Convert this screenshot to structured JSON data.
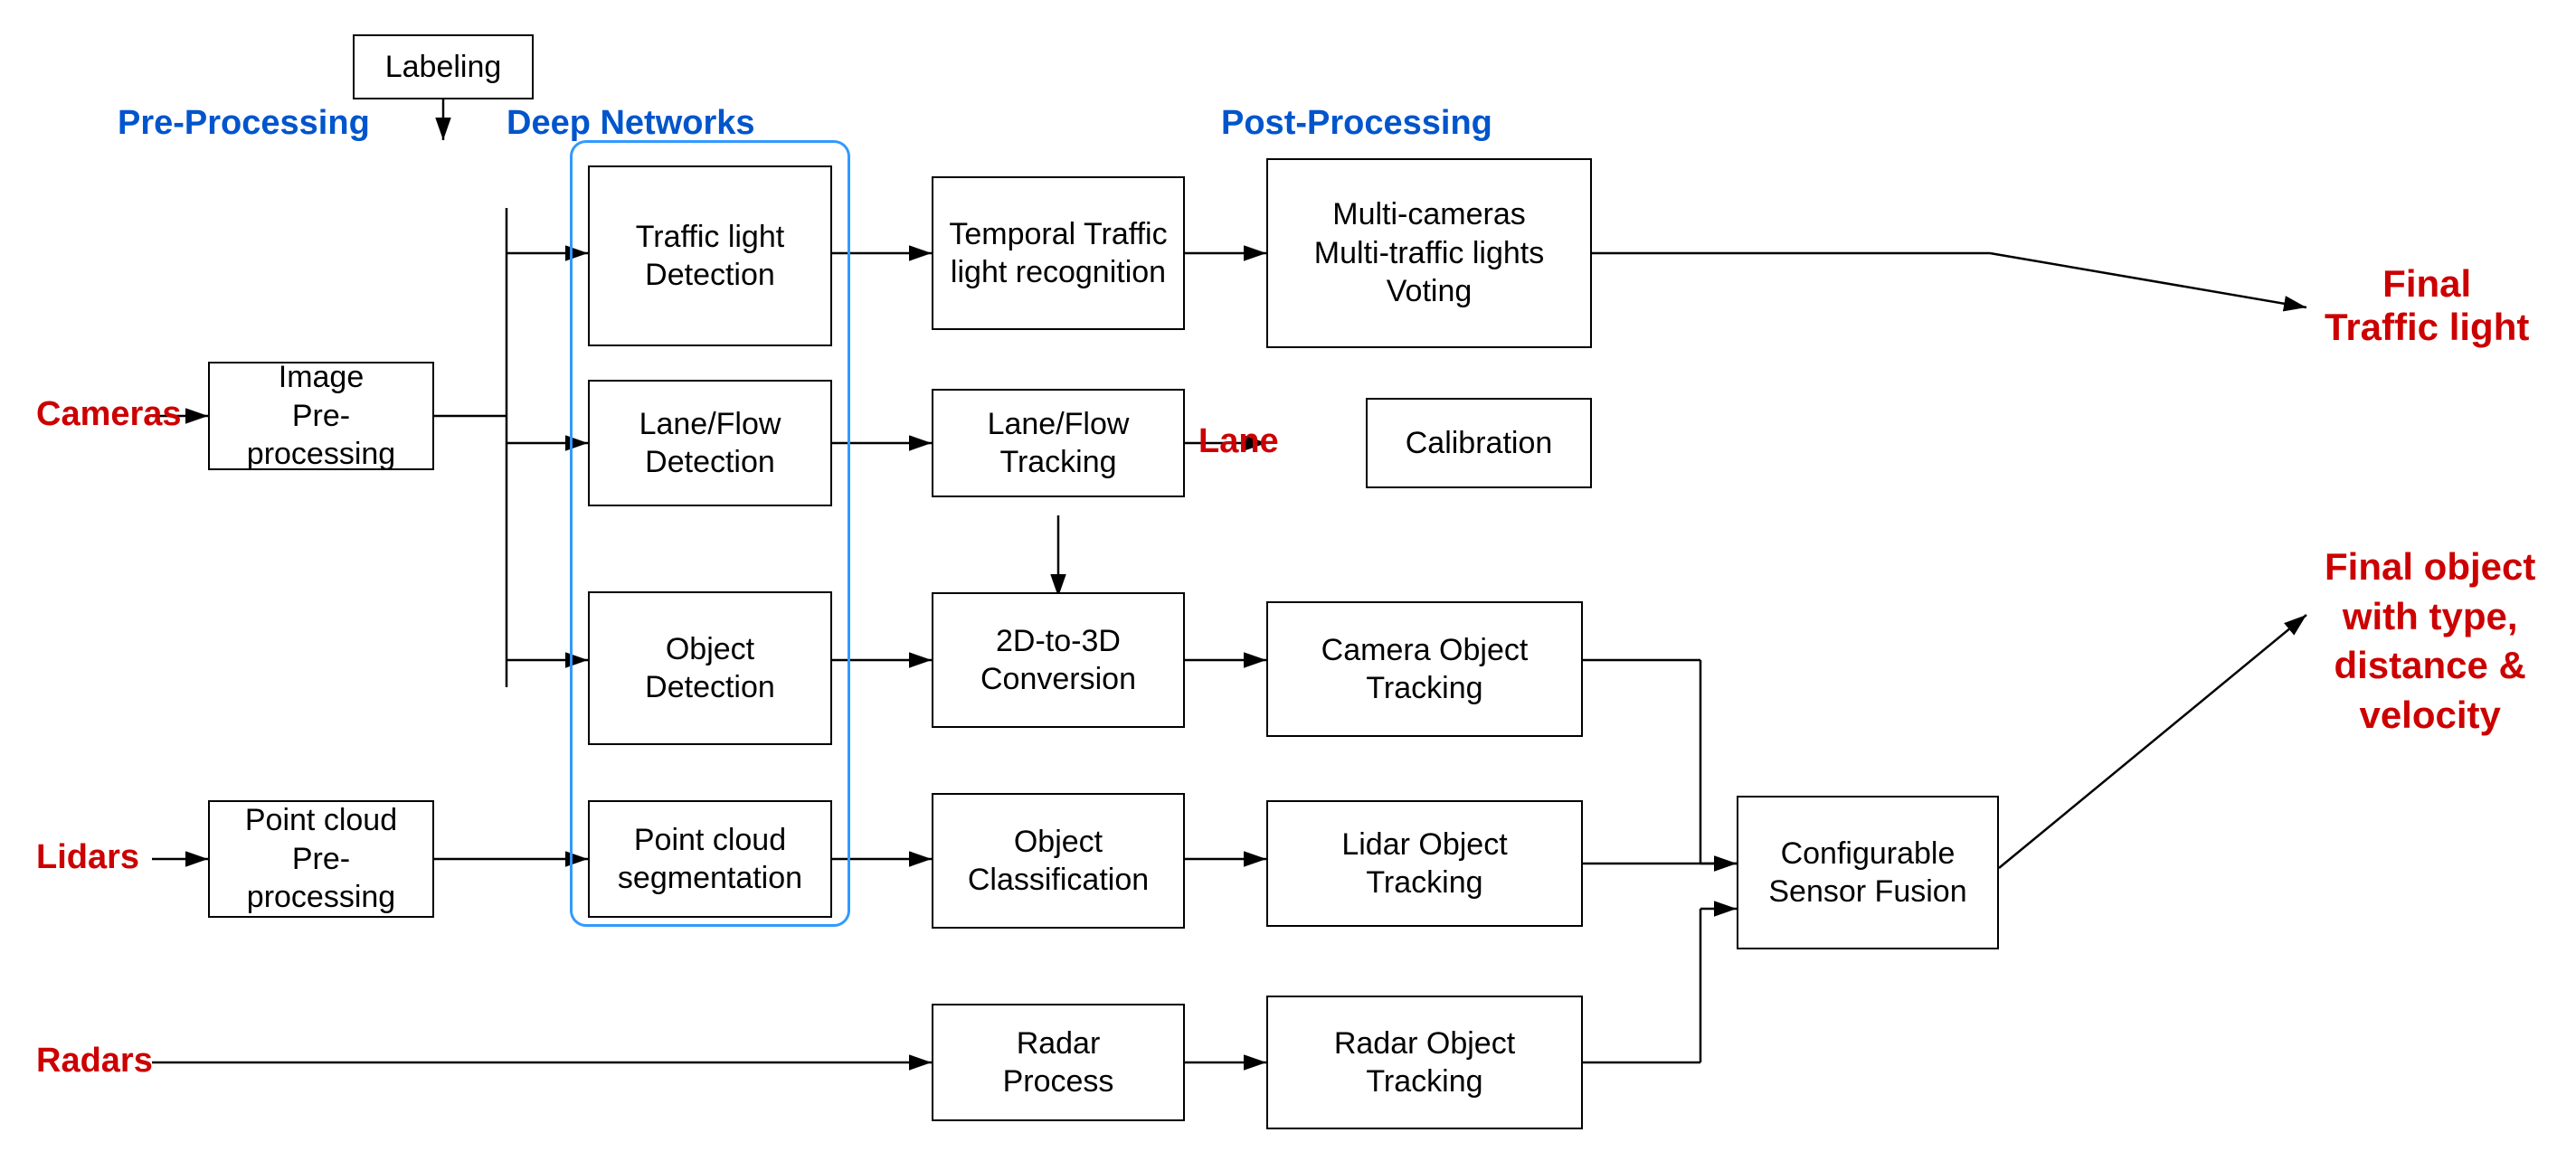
{
  "labels": {
    "cameras": "Cameras",
    "lidars": "Lidars",
    "radars": "Radars",
    "pre_processing": "Pre-Processing",
    "deep_networks": "Deep Networks",
    "post_processing": "Post-Processing",
    "final_traffic_light": "Final\nTraffic light",
    "final_object": "Final object\nwith type,\ndistance &\nvelocity",
    "lane": "Lane"
  },
  "boxes": {
    "labeling": "Labeling",
    "image_preprocessing": "Image\nPre-processing",
    "traffic_light_detection": "Traffic light\nDetection",
    "lane_flow_detection": "Lane/Flow\nDetection",
    "object_detection": "Object\nDetection",
    "point_cloud_preprocessing": "Point cloud\nPre-processing",
    "point_cloud_segmentation": "Point cloud\nsegmentation",
    "temporal_traffic": "Temporal Traffic\nlight recognition",
    "lane_flow_tracking": "Lane/Flow\nTracking",
    "twod_to_threed": "2D-to-3D\nConversion",
    "object_classification": "Object\nClassification",
    "radar_process": "Radar\nProcess",
    "multi_cameras": "Multi-cameras\nMulti-traffic lights\nVoting",
    "calibration": "Calibration",
    "camera_object_tracking": "Camera Object\nTracking",
    "lidar_object_tracking": "Lidar Object\nTracking",
    "radar_object_tracking": "Radar Object\nTracking",
    "configurable_sensor_fusion": "Configurable\nSensor Fusion"
  }
}
